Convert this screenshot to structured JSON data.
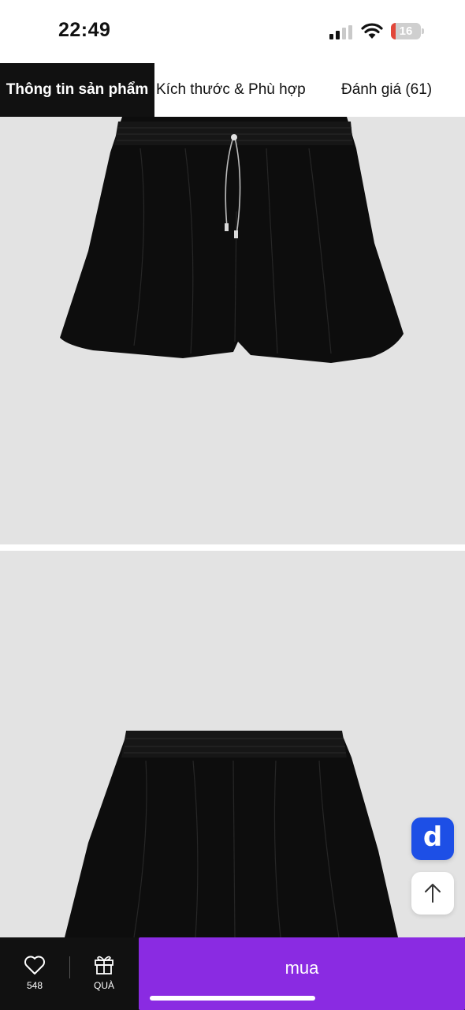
{
  "status_bar": {
    "time": "22:49",
    "battery": "16",
    "battery_level": 0.16,
    "battery_color": "#e2473a",
    "signal_bars_active": 2
  },
  "tabs": [
    {
      "label": "Thông tin sản phẩm",
      "active": true
    },
    {
      "label": "Kích thước & Phù hợp",
      "active": false
    },
    {
      "label": "Đánh giá (61)",
      "active": false
    }
  ],
  "gallery": {
    "images": [
      {
        "name": "shorts-front-image"
      },
      {
        "name": "shorts-back-image"
      }
    ],
    "background": "#e3e3e3"
  },
  "floating": {
    "app_icon_letter": "d",
    "app_icon_color": "#1d4fe6",
    "scroll_top_icon": "arrow-up-icon"
  },
  "bottom_bar": {
    "wishlist_icon": "heart-icon",
    "wishlist_count": "548",
    "gift_icon": "gift-icon",
    "gift_label": "QUÀ",
    "buy_label": "mua",
    "buy_color": "#8a2be2"
  }
}
